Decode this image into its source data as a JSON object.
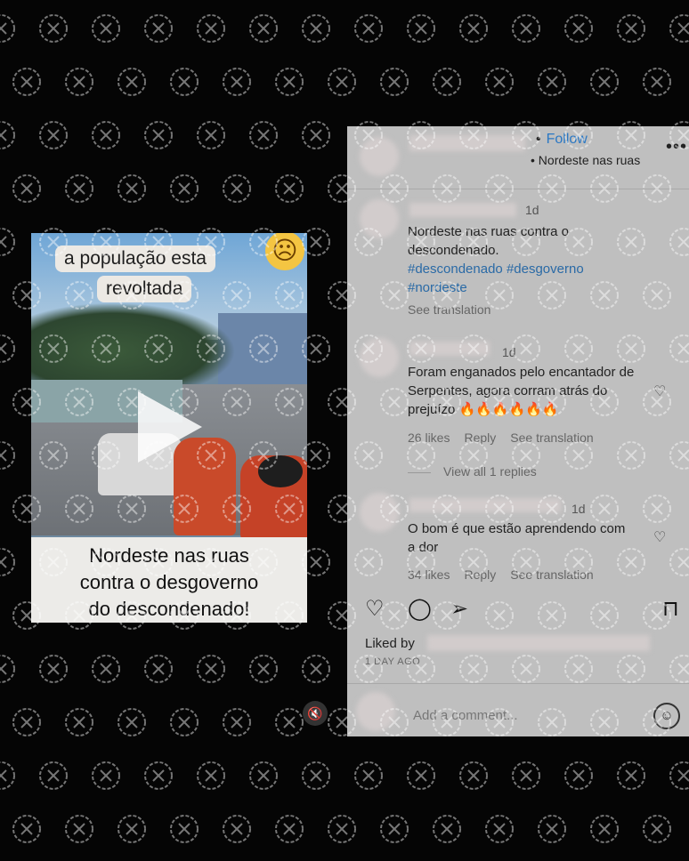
{
  "video": {
    "overlay_line1": "a população  esta",
    "overlay_line2": "revoltada",
    "caption_line1": "Nordeste nas ruas",
    "caption_line2": "contra o desgoverno",
    "caption_line3": "do descondenado!"
  },
  "post": {
    "follow_label": "Follow",
    "location": "Nordeste nas ruas",
    "more_label": "•••",
    "caption_time": "1d",
    "caption_text": "Nordeste nas ruas contra o descondenado.",
    "hashtags": [
      "#descondenado",
      "#desgoverno",
      "#nordeste"
    ],
    "see_translation": "See translation"
  },
  "comments": [
    {
      "time": "1d",
      "text": "Foram enganados pelo encantador de Serpentes, agora corram atrás do prejuízo 🔥🔥🔥🔥🔥🔥",
      "likes": "26 likes",
      "reply": "Reply",
      "translation": "See translation"
    },
    {
      "time": "1d",
      "text": "O bom é que estão aprendendo com a dor",
      "likes": "34 likes",
      "reply": "Reply",
      "translation": "See translation"
    }
  ],
  "view_all_replies": "View all 1 replies",
  "liked_by": "Liked by",
  "posted_ago": "1 DAY AGO",
  "add_comment_placeholder": "Add a comment...",
  "icons": [
    "heart-icon",
    "comment-icon",
    "share-icon",
    "bookmark-icon",
    "emoji-icon",
    "mute-icon",
    "play-icon"
  ]
}
